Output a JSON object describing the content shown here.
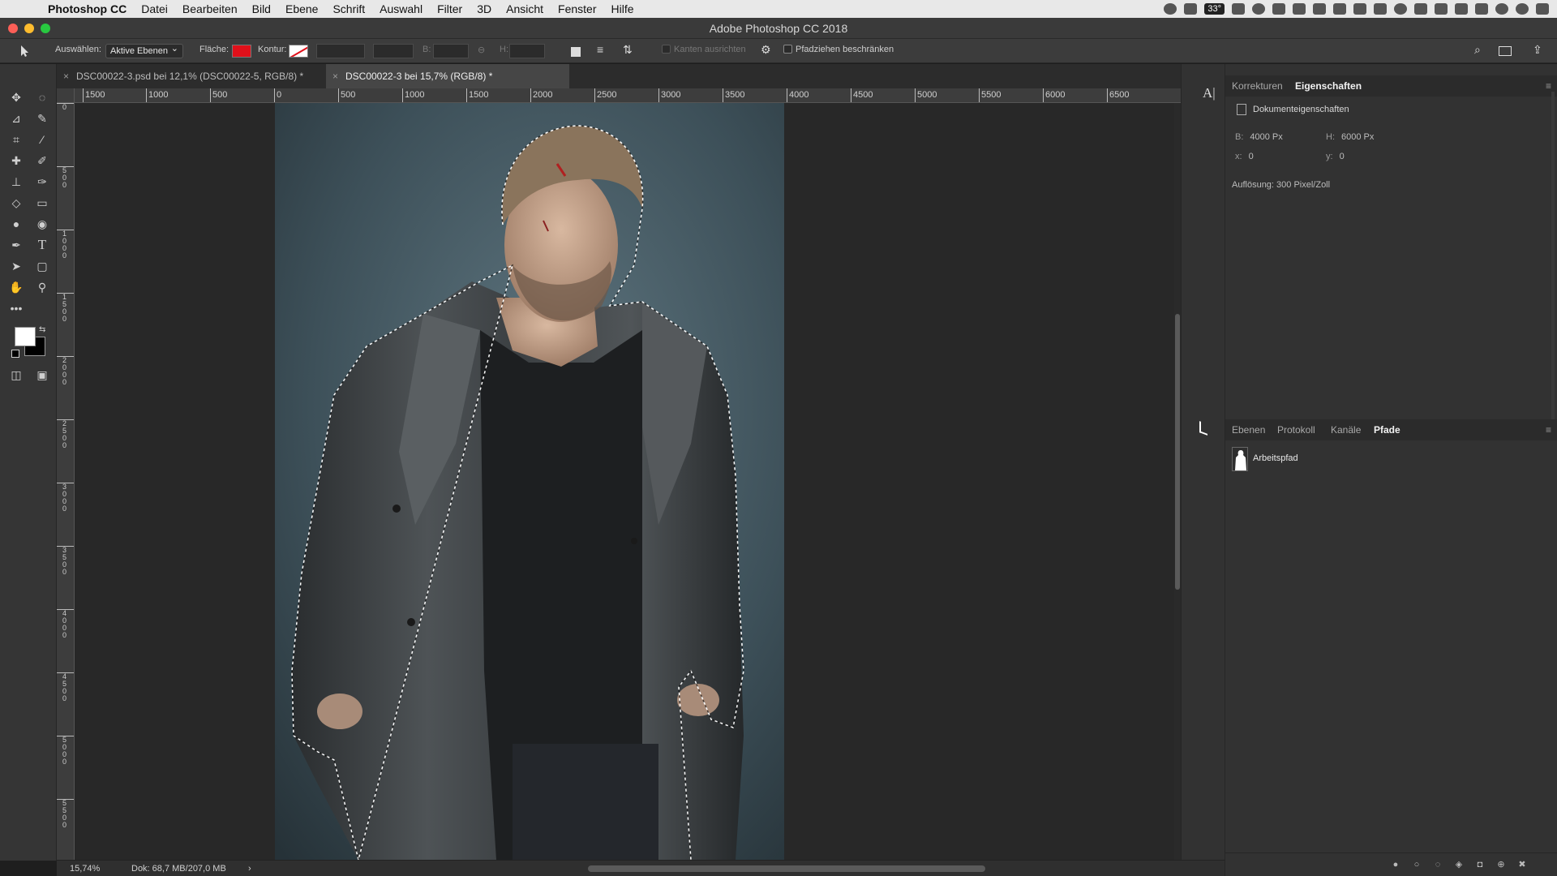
{
  "menubar": {
    "app_name": "Photoshop CC",
    "items": [
      "Datei",
      "Bearbeiten",
      "Bild",
      "Ebene",
      "Schrift",
      "Auswahl",
      "Filter",
      "3D",
      "Ansicht",
      "Fenster",
      "Hilfe"
    ],
    "status_temp": "33°"
  },
  "window": {
    "title": "Adobe Photoshop CC 2018"
  },
  "options_bar": {
    "select_label": "Auswählen:",
    "select_value": "Aktive Ebenen",
    "fill_label": "Fläche:",
    "fill_color": "#e0101a",
    "stroke_label": "Kontur:",
    "width_label": "B:",
    "height_label": "H:",
    "align_edges_label": "Kanten ausrichten",
    "constrain_label": "Pfadziehen beschränken"
  },
  "tabs": [
    {
      "label": "DSC00022-3.psd bei 12,1% (DSC00022-5, RGB/8) *",
      "active": false
    },
    {
      "label": "DSC00022-3 bei 15,7% (RGB/8) *",
      "active": true
    }
  ],
  "ruler": {
    "h_labels": [
      "1500",
      "1000",
      "500",
      "0",
      "500",
      "1000",
      "1500",
      "2000",
      "2500",
      "3000",
      "3500",
      "4000",
      "4500",
      "5000",
      "5500",
      "6000",
      "6500"
    ],
    "v_labels": [
      "0",
      "5\n0\n0",
      "1\n0\n0\n0",
      "1\n5\n0\n0",
      "2\n0\n0\n0",
      "2\n5\n0\n0",
      "3\n0\n0\n0",
      "3\n5\n0\n0",
      "4\n0\n0\n0",
      "4\n5\n0\n0",
      "5\n0\n0\n0",
      "5\n5\n0\n0"
    ]
  },
  "statusbar": {
    "zoom": "15,74%",
    "doc": "Dok: 68,7 MB/207,0 MB",
    "arrow": "›"
  },
  "properties_panel": {
    "tabs": [
      "Korrekturen",
      "Eigenschaften"
    ],
    "active_tab": "Eigenschaften",
    "section_title": "Dokumenteigenschaften",
    "width_label": "B:",
    "width_value": "4000 Px",
    "height_label": "H:",
    "height_value": "6000 Px",
    "x_label": "x:",
    "x_value": "0",
    "y_label": "y:",
    "y_value": "0",
    "resolution": "Auflösung: 300 Pixel/Zoll"
  },
  "layers_panel": {
    "tabs": [
      "Ebenen",
      "Protokoll",
      "Kanäle",
      "Pfade"
    ],
    "active_tab": "Pfade",
    "paths": [
      {
        "name": "Arbeitspfad"
      }
    ]
  },
  "colors": {
    "foreground": "#ffffff",
    "background": "#000000"
  }
}
